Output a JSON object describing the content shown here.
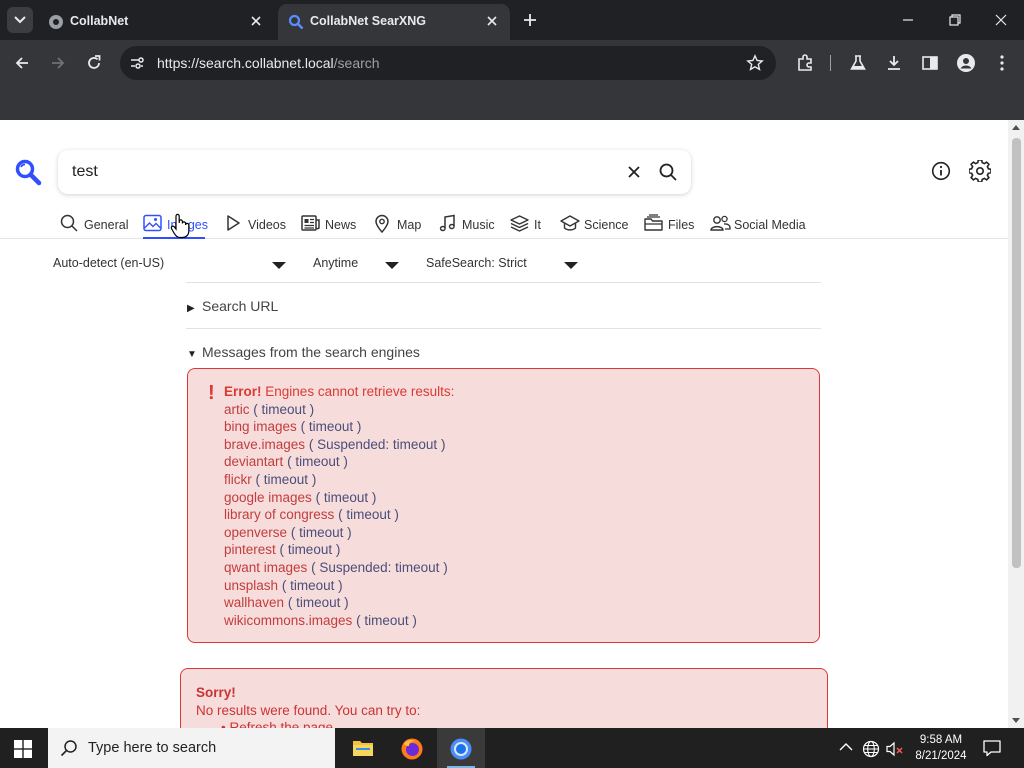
{
  "browser": {
    "tabs": [
      {
        "title": "CollabNet",
        "active": false
      },
      {
        "title": "CollabNet SearXNG",
        "active": true
      }
    ],
    "url_host": "https://search.collabnet.local",
    "url_path": "/search"
  },
  "search": {
    "query": "test"
  },
  "categories": [
    {
      "label": "General",
      "icon": "search-icon"
    },
    {
      "label": "Images",
      "icon": "image-icon",
      "active": true
    },
    {
      "label": "Videos",
      "icon": "play-icon"
    },
    {
      "label": "News",
      "icon": "newspaper-icon"
    },
    {
      "label": "Map",
      "icon": "map-pin-icon"
    },
    {
      "label": "Music",
      "icon": "music-icon"
    },
    {
      "label": "It",
      "icon": "layers-icon"
    },
    {
      "label": "Science",
      "icon": "school-icon"
    },
    {
      "label": "Files",
      "icon": "files-icon"
    },
    {
      "label": "Social Media",
      "icon": "people-icon"
    }
  ],
  "filters": {
    "language": "Auto-detect (en-US)",
    "time": "Anytime",
    "safesearch": "SafeSearch: Strict"
  },
  "sections": {
    "search_url": "Search URL",
    "messages": "Messages from the search engines"
  },
  "error": {
    "title": "Error!",
    "message": "Engines cannot retrieve results:",
    "engines": [
      {
        "name": "artic",
        "reason": "timeout"
      },
      {
        "name": "bing images",
        "reason": "timeout"
      },
      {
        "name": "brave.images",
        "reason": "Suspended: timeout"
      },
      {
        "name": "deviantart",
        "reason": "timeout"
      },
      {
        "name": "flickr",
        "reason": "timeout"
      },
      {
        "name": "google images",
        "reason": "timeout"
      },
      {
        "name": "library of congress",
        "reason": "timeout"
      },
      {
        "name": "openverse",
        "reason": "timeout"
      },
      {
        "name": "pinterest",
        "reason": "timeout"
      },
      {
        "name": "qwant images",
        "reason": "Suspended: timeout"
      },
      {
        "name": "unsplash",
        "reason": "timeout"
      },
      {
        "name": "wallhaven",
        "reason": "timeout"
      },
      {
        "name": "wikicommons.images",
        "reason": "timeout"
      }
    ]
  },
  "sorry": {
    "title": "Sorry!",
    "message": "No results were found. You can try to:",
    "suggestion": "Refresh the page."
  },
  "taskbar": {
    "search_placeholder": "Type here to search",
    "time": "9:58 AM",
    "date": "8/21/2024"
  },
  "colors": {
    "accent": "#3050ff",
    "error_border": "#db3a34",
    "error_bg": "#f7dcdc"
  }
}
